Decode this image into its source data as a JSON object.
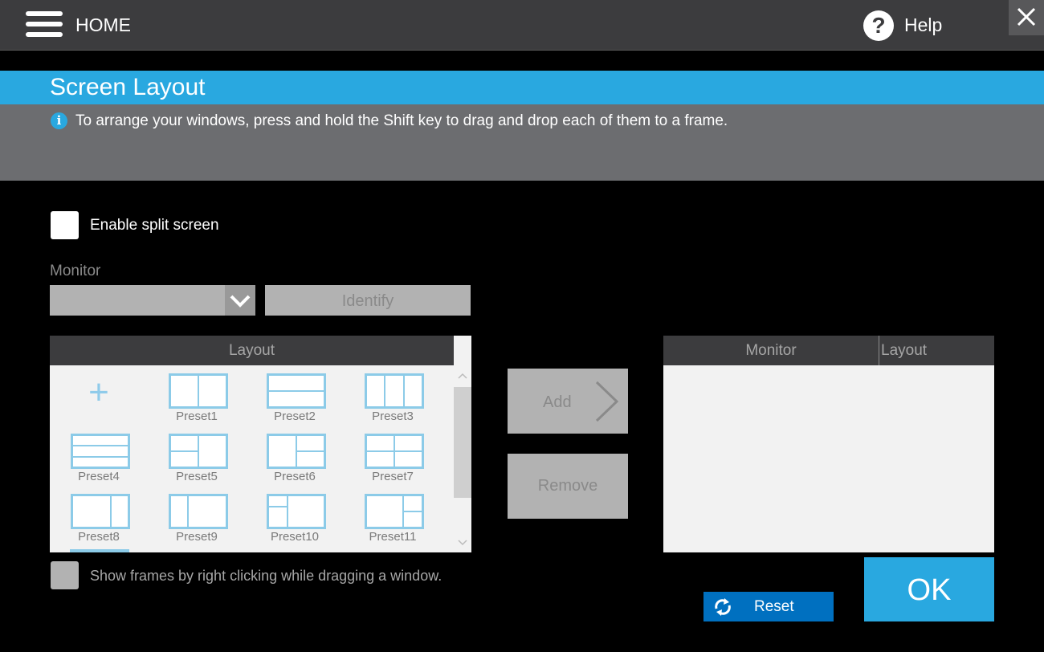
{
  "header": {
    "home_label": "HOME",
    "help_label": "Help",
    "help_icon": "?",
    "close_icon": "close-icon"
  },
  "page": {
    "title": "Screen Layout",
    "info_icon": "i",
    "info_text": "To arrange your windows, press and hold the Shift key to drag and drop each of them to a frame."
  },
  "split_screen": {
    "label": "Enable split screen",
    "checked": false
  },
  "monitor": {
    "label": "Monitor",
    "selected_value": "",
    "identify_label": "Identify"
  },
  "layout_list": {
    "header": "Layout",
    "add_icon": "+",
    "presets": [
      "Preset1",
      "Preset2",
      "Preset3",
      "Preset4",
      "Preset5",
      "Preset6",
      "Preset7",
      "Preset8",
      "Preset9",
      "Preset10",
      "Preset11"
    ]
  },
  "actions": {
    "add_label": "Add",
    "remove_label": "Remove"
  },
  "assigned_table": {
    "columns": [
      "Monitor",
      "Layout"
    ],
    "rows": []
  },
  "show_frames": {
    "label": "Show frames by right clicking while dragging a window.",
    "checked": false
  },
  "footer": {
    "reset_label": "Reset",
    "ok_label": "OK"
  },
  "colors": {
    "accent": "#29a8e0",
    "reset_blue": "#0070c0",
    "topbar": "#3c3c3e",
    "info_band": "#6c6d70",
    "disabled": "#b2b2b2"
  }
}
